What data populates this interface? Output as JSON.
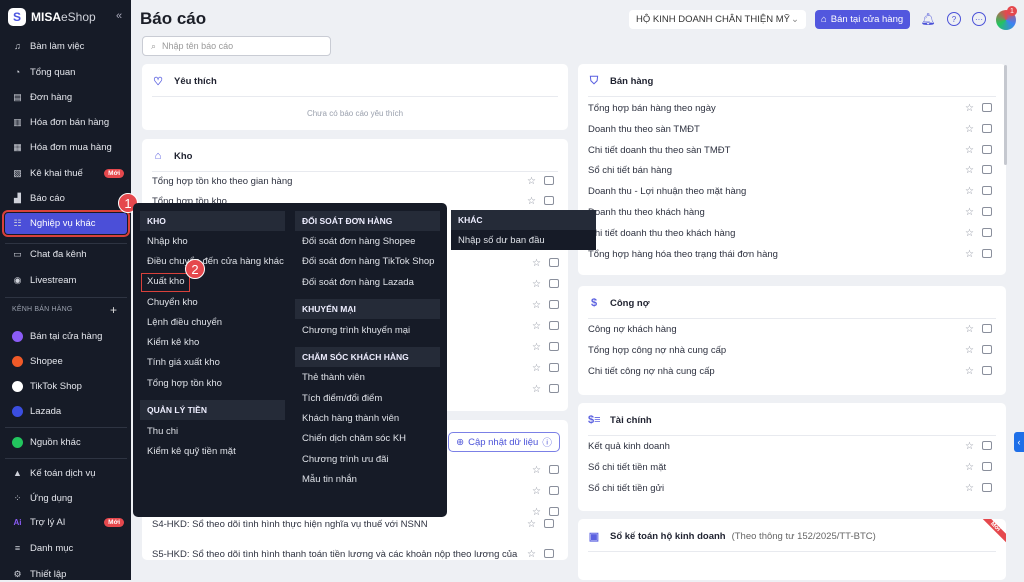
{
  "app": {
    "brand": "MISA",
    "brand_suffix": "eShop",
    "collapse": "«"
  },
  "sidebar": {
    "items": [
      {
        "label": "Bàn làm việc",
        "icon": "♫",
        "name": "desk"
      },
      {
        "label": "Tổng quan",
        "icon": "◔",
        "name": "overview"
      },
      {
        "label": "Đơn hàng",
        "icon": "▤",
        "name": "orders"
      },
      {
        "label": "Hóa đơn bán hàng",
        "icon": "▥",
        "name": "sales-invoice"
      },
      {
        "label": "Hóa đơn mua hàng",
        "icon": "▦",
        "name": "purchase-invoice"
      },
      {
        "label": "Kê khai thuế",
        "icon": "▧",
        "name": "tax",
        "badge": "Mới"
      },
      {
        "label": "Báo cáo",
        "icon": "▟",
        "name": "reports"
      },
      {
        "label": "Nghiệp vụ khác",
        "icon": "☷",
        "name": "other-operations"
      },
      {
        "label": "Chat đa kênh",
        "icon": "▭",
        "name": "chat"
      },
      {
        "label": "Livestream",
        "icon": "◉",
        "name": "livestream"
      }
    ],
    "channels_title": "KÊNH BÁN HÀNG",
    "channels_add": "+",
    "channels": [
      {
        "label": "Bán tại cửa hàng",
        "color": "#8b5cf6",
        "name": "store"
      },
      {
        "label": "Shopee",
        "color": "#f05a28",
        "name": "shopee"
      },
      {
        "label": "TikTok Shop",
        "color": "#ffffff",
        "name": "tiktok"
      },
      {
        "label": "Lazada",
        "color": "#3b4ee0",
        "name": "lazada"
      }
    ],
    "other_source": {
      "label": "Nguồn khác",
      "color": "#22c55e"
    },
    "bottom": [
      {
        "label": "Kế toán dịch vụ",
        "icon": "▲",
        "name": "accounting-service"
      },
      {
        "label": "Ứng dụng",
        "icon": "⁘",
        "name": "apps"
      },
      {
        "label": "Trợ lý AI",
        "icon": "Ai",
        "name": "ai-assistant",
        "badge": "Mới"
      },
      {
        "label": "Danh mục",
        "icon": "≡",
        "name": "catalog"
      },
      {
        "label": "Thiết lập",
        "icon": "⚙",
        "name": "settings"
      }
    ]
  },
  "steps": {
    "one": "1",
    "two": "2"
  },
  "header": {
    "title": "Báo cáo",
    "search_placeholder": "Nhập tên báo cáo",
    "store": "HỘ KINH DOANH CHÂN THIỆN MỸ",
    "sell_button": "Bán tại cửa hàng",
    "notif_count": "1"
  },
  "favorites": {
    "title": "Yêu thích",
    "empty": "Chưa có báo cáo yêu thích"
  },
  "kho": {
    "title": "Kho",
    "rows": [
      "Tổng hợp tồn kho theo gian hàng",
      "Tổng hợp tồn kho"
    ]
  },
  "ledger_left": {
    "update_button": "Cập nhật dữ liệu",
    "rows": [
      "S4-HKD: Sổ theo dõi tình hình thực hiện nghĩa vụ thuế với NSNN",
      "S5-HKD: Sổ theo dõi tình hình thanh toán tiền lương và các khoản nộp theo lương của"
    ]
  },
  "sales": {
    "title": "Bán hàng",
    "rows": [
      "Tổng hợp bán hàng theo ngày",
      "Doanh thu theo sàn TMĐT",
      "Chi tiết doanh thu theo sàn TMĐT",
      "Sổ chi tiết bán hàng",
      "Doanh thu - Lợi nhuận theo mặt hàng",
      "Doanh thu theo khách hàng",
      "Chi tiết doanh thu theo khách hàng",
      "Tổng hợp hàng hóa theo trạng thái đơn hàng"
    ]
  },
  "debt": {
    "title": "Công nợ",
    "rows": [
      "Công nợ khách hàng",
      "Tổng hợp công nợ nhà cung cấp",
      "Chi tiết công nợ nhà cung cấp"
    ]
  },
  "finance": {
    "title": "Tài chính",
    "rows": [
      "Kết quả kinh doanh",
      "Sổ chi tiết tiền mặt",
      "Sổ chi tiết tiền gửi"
    ]
  },
  "ledger": {
    "title": "Sổ kế toán hộ kinh doanh",
    "subtitle": "(Theo thông tư 152/2025/TT-BTC)",
    "ribbon": "Mới"
  },
  "menu": {
    "kho": {
      "title": "KHO",
      "items": [
        "Nhập kho",
        "Điều chuyển đến cửa hàng khác",
        "Xuất kho",
        "Chuyển kho",
        "Lệnh điều chuyển",
        "Kiểm kê kho",
        "Tính giá xuất kho",
        "Tổng hợp tồn kho"
      ]
    },
    "money": {
      "title": "QUẢN LÝ TIỀN",
      "items": [
        "Thu chi",
        "Kiểm kê quỹ tiền mặt"
      ]
    },
    "reconcile": {
      "title": "ĐỐI SOÁT ĐƠN HÀNG",
      "items": [
        "Đối soát đơn hàng Shopee",
        "Đối soát đơn hàng TikTok Shop",
        "Đối soát đơn hàng Lazada"
      ]
    },
    "promo": {
      "title": "KHUYẾN MẠI",
      "items": [
        "Chương trình khuyến mại"
      ]
    },
    "care": {
      "title": "CHĂM SÓC KHÁCH HÀNG",
      "items": [
        "Thẻ thành viên",
        "Tích điểm/đổi điểm",
        "Khách hàng thành viên",
        "Chiến dịch chăm sóc KH",
        "Chương trình ưu đãi",
        "Mẫu tin nhắn"
      ]
    },
    "other": {
      "title": "KHÁC",
      "items": [
        "Nhập số dư ban đầu"
      ]
    }
  }
}
